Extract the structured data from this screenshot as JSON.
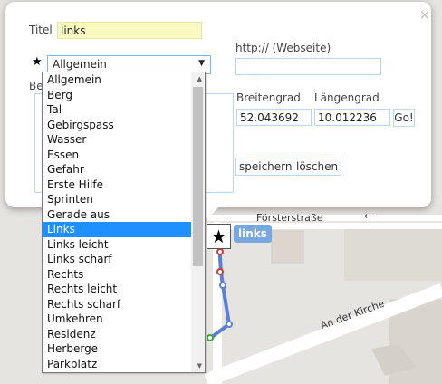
{
  "map": {
    "street1": "Försterstraße",
    "street2": "An der Kirche",
    "oneway_arrow": "←"
  },
  "popup": {
    "close_glyph": "×",
    "title_label": "Titel",
    "title_value": "links",
    "star_glyph": "★",
    "category_selected": "Allgemein",
    "category_arrow": "▼",
    "web_label": "http:// (Webseite)",
    "web_value": "",
    "desc_label_partial": "Be",
    "lat_label": "Breitengrad",
    "lon_label": "Längengrad",
    "lat_value": "52.043692",
    "lon_value": "10.012236",
    "go_label": "Go!",
    "save_label": "speichern",
    "delete_label": "löschen"
  },
  "dropdown": {
    "selected_index": 10,
    "options": [
      "Allgemein",
      "Berg",
      "Tal",
      "Gebirgspass",
      "Wasser",
      "Essen",
      "Gefahr",
      "Erste Hilfe",
      "Sprinten",
      "Gerade aus",
      "Links",
      "Links leicht",
      "Links scharf",
      "Rechts",
      "Rechts leicht",
      "Rechts scharf",
      "Umkehren",
      "Residenz",
      "Herberge",
      "Parkplatz"
    ],
    "scroll_up": "▲",
    "scroll_down": "▼"
  },
  "marker": {
    "icon": "★",
    "label": "links"
  },
  "colors": {
    "title_bg": "#fafac0",
    "selected_option": "#1e90ff",
    "marker_label_bg": "#78a8e0",
    "route": "#5b7fd6"
  }
}
